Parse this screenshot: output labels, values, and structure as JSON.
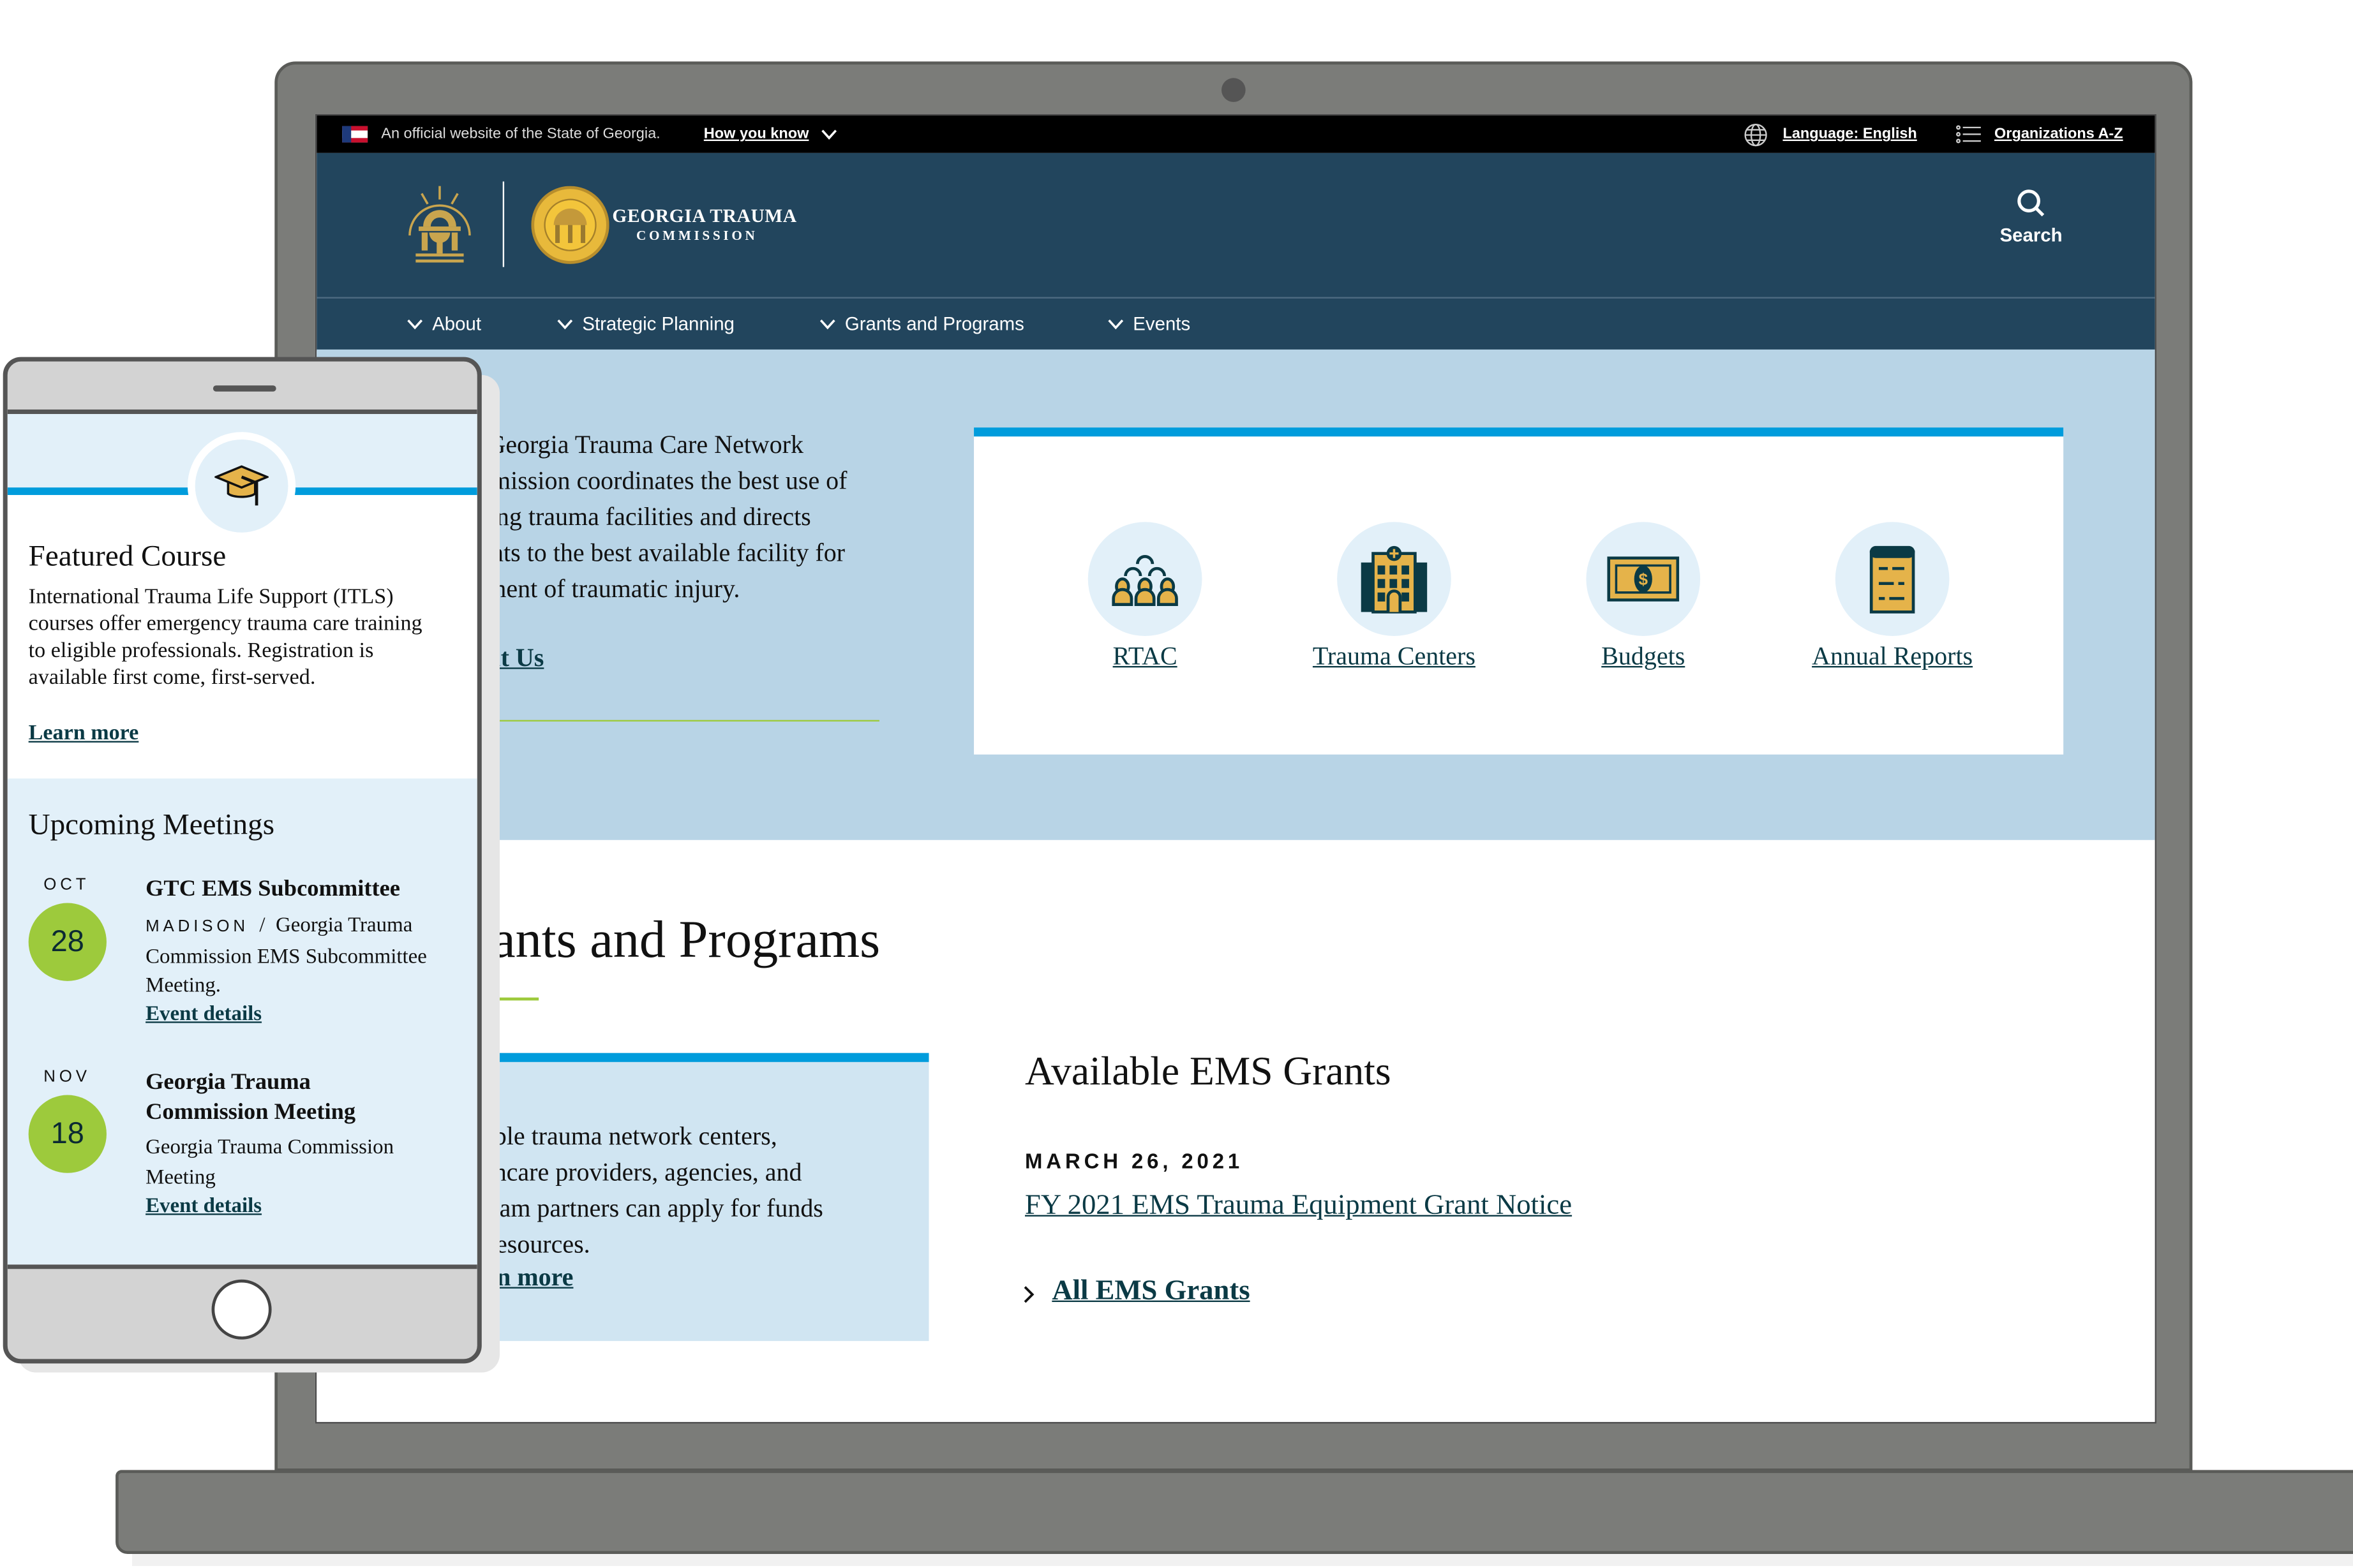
{
  "colors": {
    "header_bg": "#22455d",
    "hero_bg": "#b8d4e6",
    "accent_blue": "#009cdc",
    "accent_green": "#9dca3c",
    "icon_gold": "#e5b34a",
    "link": "#0b3a45"
  },
  "topbar": {
    "official": "An official website of the State of Georgia.",
    "how_you_know": "How you know",
    "language": "Language: English",
    "organizations": "Organizations A-Z"
  },
  "header": {
    "logo_title": "GEORGIA TRAUMA",
    "logo_subtitle": "COMMISSION",
    "search_label": "Search"
  },
  "nav": [
    {
      "label": "About"
    },
    {
      "label": "Strategic Planning"
    },
    {
      "label": "Grants and Programs"
    },
    {
      "label": "Events"
    }
  ],
  "hero": {
    "text": "The Georgia Trauma Care Network Commission coordinates the best use of existing trauma facilities and directs patients to the best available facility for treatment of traumatic injury.",
    "link": "About Us"
  },
  "quick_links": [
    {
      "label": "RTAC",
      "icon": "people-group-icon"
    },
    {
      "label": "Trauma Centers",
      "icon": "hospital-icon"
    },
    {
      "label": "Budgets",
      "icon": "money-bill-icon"
    },
    {
      "label": "Annual Reports",
      "icon": "scroll-icon"
    }
  ],
  "grants": {
    "heading": "Grants and Programs",
    "box_text": "Eligible trauma network centers, healthcare providers, agencies, and program partners can apply for funds and resources.",
    "box_link": "Learn more",
    "available_heading": "Available EMS Grants",
    "date": "MARCH 26, 2021",
    "notice_link": "FY 2021 EMS Trauma Equipment Grant Notice",
    "all_link": "All EMS Grants"
  },
  "phone": {
    "featured": {
      "title": "Featured Course",
      "body": "International Trauma Life Support (ITLS) courses offer emergency trauma care training to eligible professionals. Registration is available first come, first-served.",
      "link": "Learn more"
    },
    "meetings_heading": "Upcoming Meetings",
    "meetings": [
      {
        "month": "OCT",
        "day": "28",
        "title": "GTC EMS Subcommittee",
        "location": "MADISON",
        "desc": "Georgia Trauma Commission EMS Subcommittee Meeting.",
        "link": "Event details"
      },
      {
        "month": "NOV",
        "day": "18",
        "title": "Georgia Trauma Commission Meeting",
        "location": "",
        "desc": "Georgia Trauma Commission Meeting",
        "link": "Event details"
      }
    ]
  }
}
